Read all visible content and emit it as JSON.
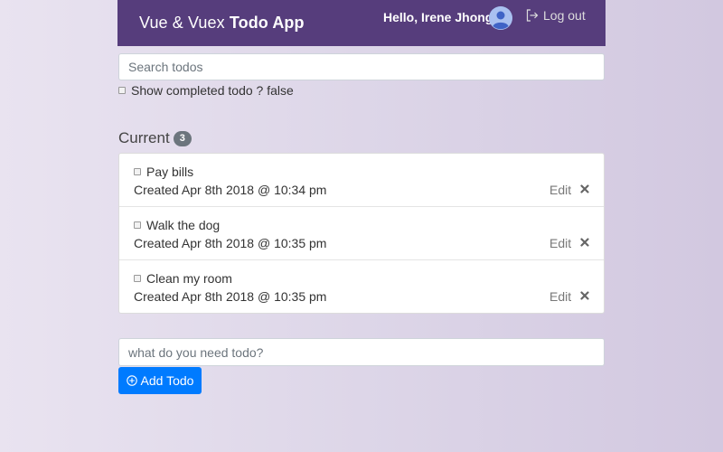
{
  "header": {
    "brand_prefix": "Vue & Vuex",
    "brand_bold": "Todo App",
    "greeting": "Hello, Irene Jhong",
    "avatar_icon": "user-avatar-icon",
    "logout_label": "Log out",
    "logout_icon": "logout-icon",
    "background": "#563d7c"
  },
  "search": {
    "placeholder": "Search todos",
    "value": ""
  },
  "filter": {
    "label": "Show completed todo ? false",
    "checked": false
  },
  "current": {
    "title": "Current",
    "count": "3",
    "items": [
      {
        "title": "Pay bills",
        "created": "Created Apr 8th 2018 @ 10:34 pm",
        "edit_label": "Edit",
        "completed": false
      },
      {
        "title": "Walk the dog",
        "created": "Created Apr 8th 2018 @ 10:35 pm",
        "edit_label": "Edit",
        "completed": false
      },
      {
        "title": "Clean my room",
        "created": "Created Apr 8th 2018 @ 10:35 pm",
        "edit_label": "Edit",
        "completed": false
      }
    ]
  },
  "new_todo": {
    "placeholder": "what do you need todo?",
    "value": ""
  },
  "add_button": {
    "label": "Add Todo",
    "icon": "plus-circle-icon",
    "color": "#007bff"
  }
}
